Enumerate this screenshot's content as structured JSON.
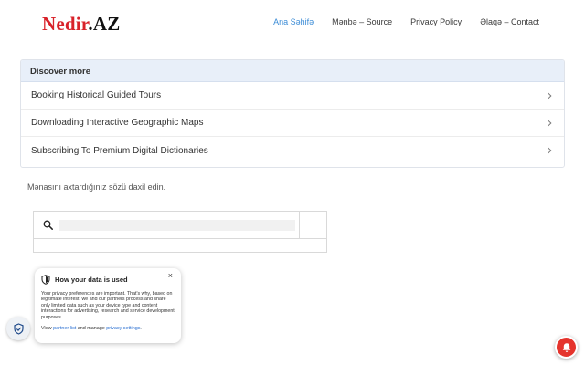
{
  "logo": {
    "main": "Nedir",
    "tld": ".AZ"
  },
  "nav": {
    "items": [
      {
        "label": "Ana Səhifə",
        "active": true
      },
      {
        "label": "Mənbə – Source",
        "active": false
      },
      {
        "label": "Privacy Policy",
        "active": false
      },
      {
        "label": "Əlaqə – Contact",
        "active": false
      }
    ]
  },
  "discover": {
    "title": "Discover more",
    "items": [
      {
        "label": "Booking Historical Guided Tours"
      },
      {
        "label": "Downloading Interactive Geographic Maps"
      },
      {
        "label": "Subscribing To Premium Digital Dictionaries"
      }
    ]
  },
  "prompt": "Mənasını axtardığınız sözü daxil edin.",
  "search": {
    "value": "",
    "placeholder": ""
  },
  "privacy": {
    "title": "How your data is used",
    "close": "×",
    "body": "Your privacy preferences are important. That's why, based on legitimate interest, we and our partners process and share only limited data such as your device type and content interactions for advertising, research and service development purposes.",
    "footer_prefix": "View ",
    "partner_link": "partner list",
    "footer_middle": " and manage ",
    "settings_link": "privacy settings",
    "footer_suffix": "."
  },
  "colors": {
    "logo_red": "#d8222a",
    "nav_active": "#3a8bd6",
    "discover_header_bg": "#e8eff9",
    "notification_red": "#e5342d",
    "link_blue": "#2a6fd1"
  },
  "icons": {
    "discover_chevron": "chevron-right-icon",
    "search": "search-icon",
    "privacy_shield": "shield-icon",
    "privacy_toggle": "shield-check-icon",
    "notification": "bell-icon"
  }
}
